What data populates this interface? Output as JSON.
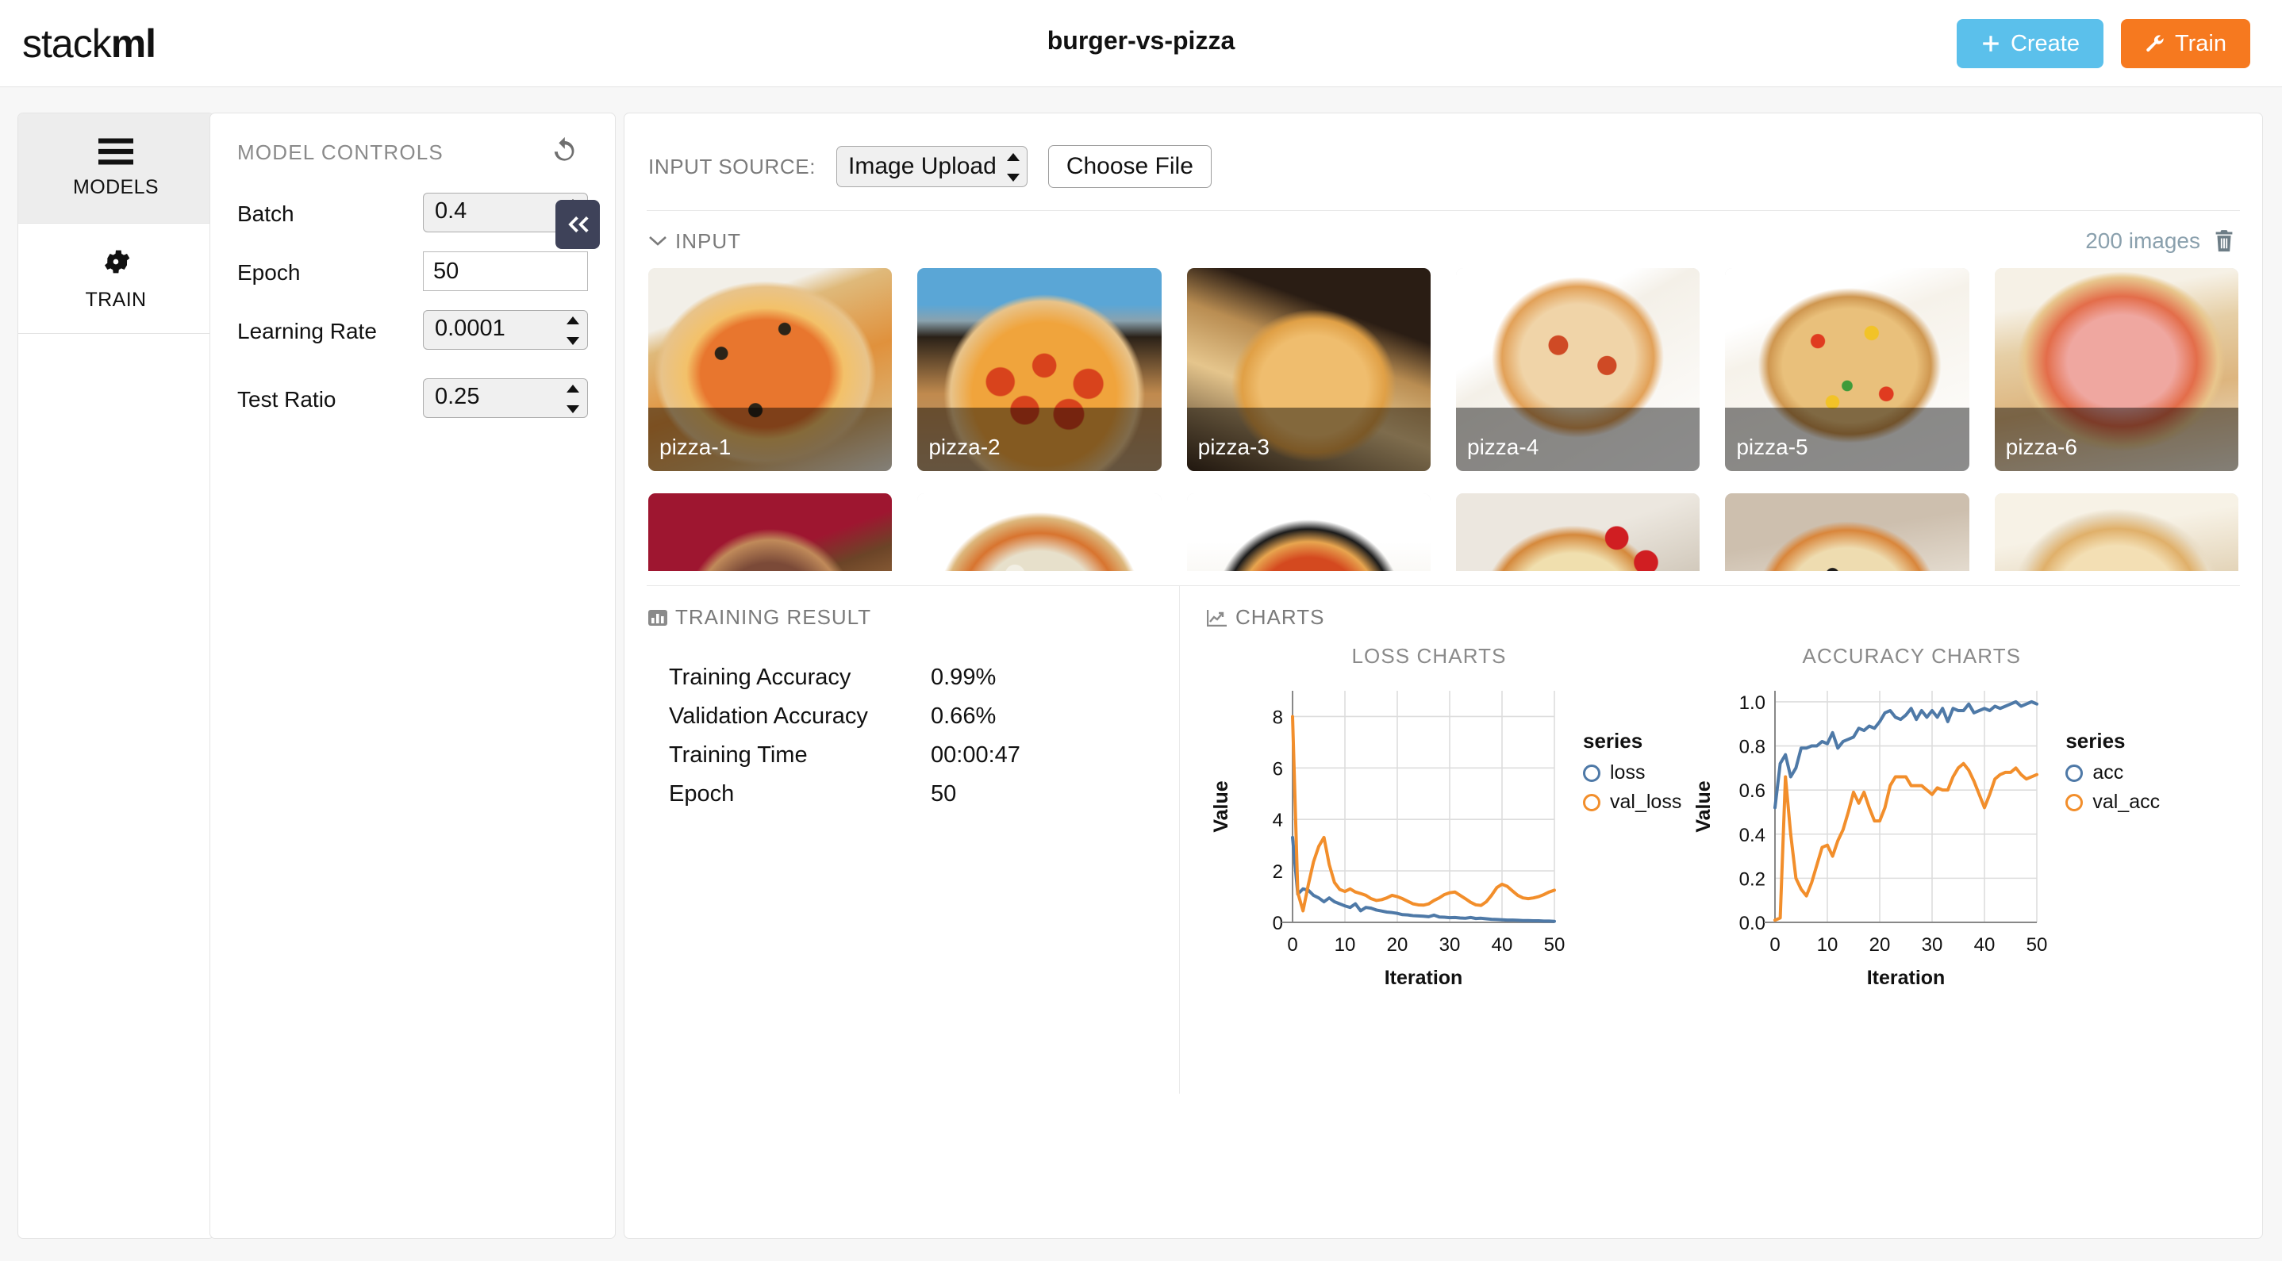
{
  "header": {
    "logo_regular": "stack",
    "logo_bold": "ml",
    "title": "burger-vs-pizza",
    "create_label": "Create",
    "train_label": "Train"
  },
  "rail": {
    "items": [
      {
        "label": "MODELS",
        "icon": "hamburger-icon",
        "active": true
      },
      {
        "label": "TRAIN",
        "icon": "gear-icon",
        "active": false
      }
    ]
  },
  "controls": {
    "title": "MODEL CONTROLS",
    "reset_icon": "undo-icon",
    "collapse_icon": "double-chevron-left-icon",
    "fields": [
      {
        "label": "Batch",
        "value": "0.4",
        "type": "stepper"
      },
      {
        "label": "Epoch",
        "value": "50",
        "type": "text"
      },
      {
        "label": "Learning Rate",
        "value": "0.0001",
        "type": "stepper"
      },
      {
        "label": "Test Ratio",
        "value": "0.25",
        "type": "stepper"
      }
    ]
  },
  "source": {
    "label": "INPUT SOURCE:",
    "select_value": "Image Upload",
    "file_button": "Choose File"
  },
  "input_section": {
    "title": "INPUT",
    "chevron_icon": "chevron-down-icon",
    "count_text": "200 images",
    "delete_icon": "trash-icon",
    "thumbs_row1": [
      {
        "caption": "pizza-1"
      },
      {
        "caption": "pizza-2"
      },
      {
        "caption": "pizza-3"
      },
      {
        "caption": "pizza-4"
      },
      {
        "caption": "pizza-5"
      },
      {
        "caption": "pizza-6"
      }
    ],
    "thumbs_row2": [
      {
        "caption": ""
      },
      {
        "caption": ""
      },
      {
        "caption": ""
      },
      {
        "caption": ""
      },
      {
        "caption": ""
      },
      {
        "caption": ""
      }
    ]
  },
  "training_result": {
    "title": "TRAINING RESULT",
    "icon": "bar-chart-icon",
    "rows": [
      {
        "key": "Training Accuracy",
        "value": "0.99%"
      },
      {
        "key": "Validation Accuracy",
        "value": "0.66%"
      },
      {
        "key": "Training Time",
        "value": "00:00:47"
      },
      {
        "key": "Epoch",
        "value": "50"
      }
    ]
  },
  "charts_section": {
    "title": "CHARTS",
    "icon": "line-chart-icon"
  },
  "chart_data": [
    {
      "type": "line",
      "title": "LOSS CHARTS",
      "xlabel": "Iteration",
      "ylabel": "Value",
      "xlim": [
        0,
        50
      ],
      "ylim": [
        0,
        9
      ],
      "xticks": [
        0,
        10,
        20,
        30,
        40,
        50
      ],
      "yticks": [
        0,
        2,
        4,
        6,
        8
      ],
      "grid": true,
      "legend_title": "series",
      "legend_position": "right",
      "series": [
        {
          "name": "loss",
          "color": "#4e79a7",
          "values": [
            3.3,
            1.1,
            1.3,
            1.25,
            1.05,
            0.95,
            0.8,
            0.95,
            0.8,
            0.72,
            0.64,
            0.58,
            0.72,
            0.45,
            0.58,
            0.55,
            0.48,
            0.44,
            0.4,
            0.38,
            0.35,
            0.3,
            0.29,
            0.26,
            0.25,
            0.24,
            0.22,
            0.28,
            0.21,
            0.2,
            0.18,
            0.19,
            0.17,
            0.16,
            0.19,
            0.15,
            0.16,
            0.14,
            0.12,
            0.11,
            0.1,
            0.09,
            0.09,
            0.08,
            0.07,
            0.07,
            0.06,
            0.06,
            0.05,
            0.05,
            0.04
          ]
        },
        {
          "name": "val_loss",
          "color": "#f28e2b",
          "values": [
            8.0,
            1.15,
            0.45,
            1.45,
            2.35,
            2.95,
            3.3,
            2.25,
            1.55,
            1.28,
            1.2,
            1.3,
            1.18,
            1.12,
            1.05,
            0.92,
            0.85,
            0.88,
            0.95,
            1.05,
            1.0,
            0.92,
            0.82,
            0.72,
            0.68,
            0.67,
            0.72,
            0.85,
            0.95,
            1.08,
            1.15,
            1.18,
            1.05,
            0.92,
            0.78,
            0.68,
            0.66,
            0.8,
            1.05,
            1.35,
            1.48,
            1.4,
            1.22,
            1.05,
            0.95,
            0.92,
            0.95,
            1.0,
            1.08,
            1.18,
            1.25
          ]
        }
      ]
    },
    {
      "type": "line",
      "title": "ACCURACY CHARTS",
      "xlabel": "Iteration",
      "ylabel": "Value",
      "xlim": [
        0,
        50
      ],
      "ylim": [
        0.0,
        1.05
      ],
      "xticks": [
        0,
        10,
        20,
        30,
        40,
        50
      ],
      "yticks": [
        0.0,
        0.2,
        0.4,
        0.6,
        0.8,
        1.0
      ],
      "grid": true,
      "legend_title": "series",
      "legend_position": "right",
      "series": [
        {
          "name": "acc",
          "color": "#4e79a7",
          "values": [
            0.52,
            0.72,
            0.76,
            0.66,
            0.7,
            0.79,
            0.79,
            0.8,
            0.8,
            0.82,
            0.81,
            0.86,
            0.79,
            0.82,
            0.83,
            0.84,
            0.88,
            0.87,
            0.89,
            0.88,
            0.91,
            0.95,
            0.96,
            0.93,
            0.92,
            0.94,
            0.97,
            0.92,
            0.96,
            0.93,
            0.96,
            0.93,
            0.97,
            0.91,
            0.97,
            0.96,
            0.96,
            0.99,
            0.95,
            0.96,
            0.97,
            0.96,
            0.98,
            0.97,
            0.98,
            0.99,
            1.0,
            0.98,
            0.99,
            1.0,
            0.99
          ]
        },
        {
          "name": "val_acc",
          "color": "#f28e2b",
          "values": [
            0.01,
            0.02,
            0.66,
            0.4,
            0.2,
            0.15,
            0.12,
            0.18,
            0.26,
            0.34,
            0.35,
            0.3,
            0.37,
            0.42,
            0.5,
            0.59,
            0.54,
            0.59,
            0.52,
            0.46,
            0.46,
            0.52,
            0.62,
            0.66,
            0.66,
            0.66,
            0.62,
            0.62,
            0.62,
            0.6,
            0.58,
            0.61,
            0.6,
            0.6,
            0.66,
            0.7,
            0.72,
            0.69,
            0.64,
            0.58,
            0.52,
            0.58,
            0.65,
            0.67,
            0.68,
            0.68,
            0.7,
            0.67,
            0.65,
            0.66,
            0.67
          ]
        }
      ]
    }
  ]
}
